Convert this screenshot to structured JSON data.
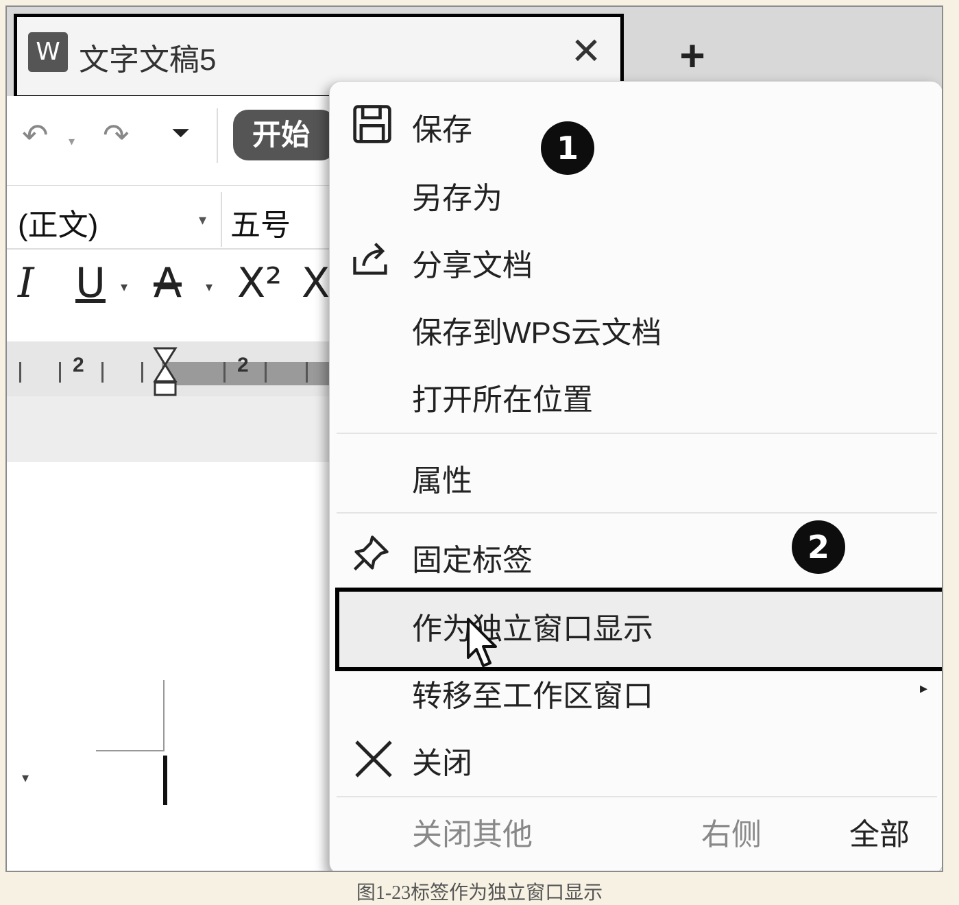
{
  "tab": {
    "app_icon": "W",
    "title": "文字文稿5",
    "close_glyph": "✕",
    "new_tab_glyph": "+"
  },
  "toolbar": {
    "undo_glyph": "↶",
    "redo_glyph": "↷",
    "customize_glyph": "⏷",
    "start_tab": "开始"
  },
  "font": {
    "family": "(正文)",
    "size": "五号"
  },
  "formatting": {
    "italic": "I",
    "underline": "U",
    "strikethrough": "A",
    "superscript": "X²",
    "subscript_partial": "X"
  },
  "ruler": {
    "numbers": [
      "2",
      "2"
    ]
  },
  "context_menu": {
    "items": [
      {
        "label": "保存",
        "icon": "save-icon"
      },
      {
        "label": "另存为",
        "icon": ""
      },
      {
        "label": "分享文档",
        "icon": "share-icon"
      },
      {
        "label": "保存到WPS云文档",
        "icon": ""
      },
      {
        "label": "打开所在位置",
        "icon": ""
      },
      {
        "label": "属性",
        "icon": ""
      },
      {
        "label": "固定标签",
        "icon": "pin-icon"
      },
      {
        "label": "作为独立窗口显示",
        "icon": "",
        "highlighted": true
      },
      {
        "label": "转移至工作区窗口",
        "icon": "",
        "has_submenu": true
      },
      {
        "label": "关闭",
        "icon": "close-icon"
      }
    ],
    "footer": {
      "close_others": "关闭其他",
      "right_side": "右侧",
      "all": "全部"
    },
    "submenu_arrow": "▸"
  },
  "badges": [
    "1",
    "2"
  ],
  "caption": "图1-23标签作为独立窗口显示"
}
